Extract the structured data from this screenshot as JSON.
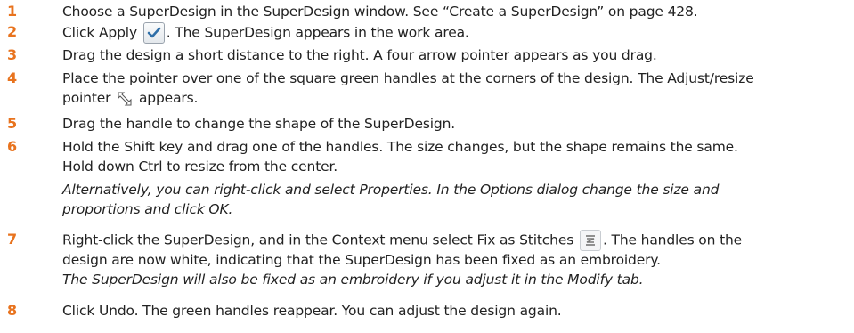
{
  "steps": [
    {
      "num": "1",
      "text": "Choose a SuperDesign in the SuperDesign window. See “Create a SuperDesign” on page 428."
    },
    {
      "num": "2",
      "text_a": "Click Apply",
      "text_b": ". The SuperDesign appears in the work area."
    },
    {
      "num": "3",
      "text": "Drag the design a short distance to the right. A four arrow pointer appears as you drag."
    },
    {
      "num": "4",
      "line1": "Place the pointer over one of the square green handles at the corners of the design. The Adjust/resize",
      "line2_a": "pointer",
      "line2_b": "appears."
    },
    {
      "num": "5",
      "text": "Drag the handle to change the shape of the SuperDesign."
    },
    {
      "num": "6",
      "line1": "Hold the Shift key and drag one of the handles. The size changes, but the shape remains the same.",
      "line2": "Hold down Ctrl to resize from the center.",
      "note1": "Alternatively, you can right-click and select Properties. In the Options dialog change the size and",
      "note2": "proportions and click OK."
    },
    {
      "num": "7",
      "line1_a": "Right-click the SuperDesign, and in the Context menu select Fix as Stitches",
      "line1_b": ". The handles on the",
      "line2": "design are now white, indicating that the SuperDesign has been fixed as an embroidery.",
      "note": "The SuperDesign will also be fixed as an embroidery if you adjust it in the Modify tab."
    },
    {
      "num": "8",
      "text": "Click Undo. The green handles reappear. You can adjust the design again."
    }
  ],
  "icons": {
    "apply": "apply-checkmark-icon",
    "resize": "adjust-resize-pointer-icon",
    "fix": "fix-as-stitches-icon"
  },
  "colors": {
    "step_number": "#e8731e",
    "text": "#222222"
  }
}
